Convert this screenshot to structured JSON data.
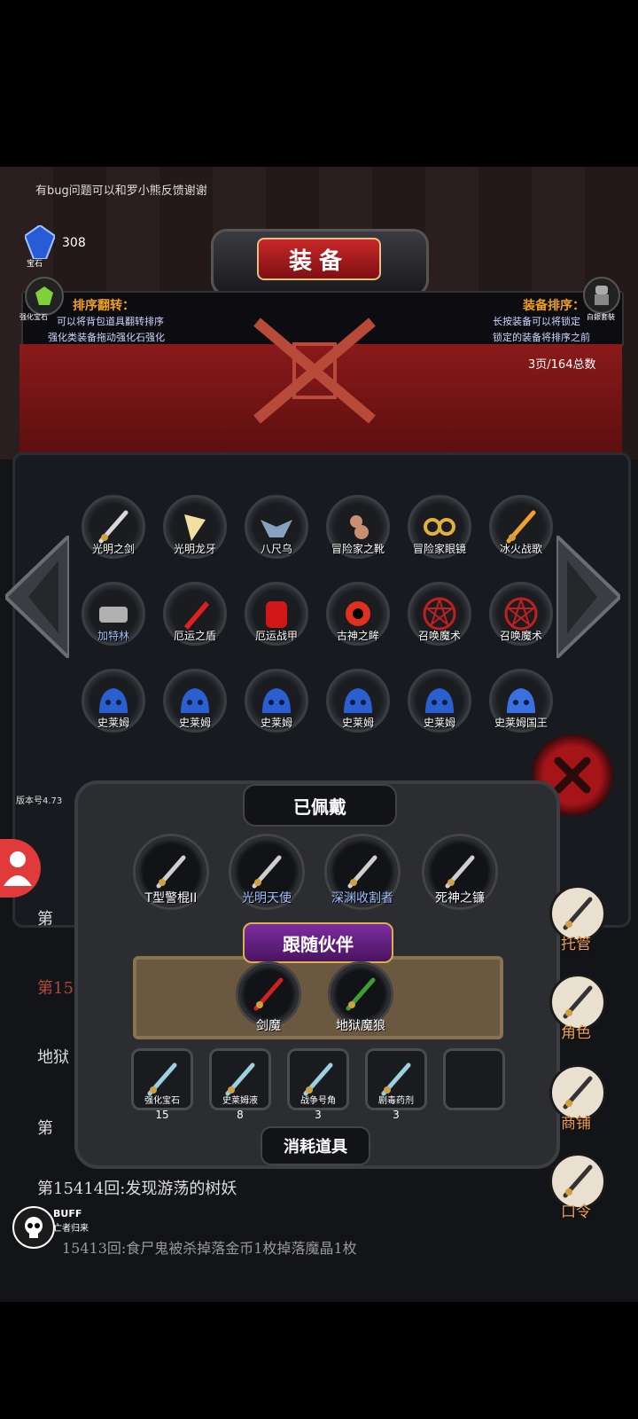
{
  "notice": "有bug问题可以和罗小熊反馈谢谢",
  "gem": {
    "count": "308",
    "label": "宝石"
  },
  "title": "装备",
  "left_badge": "强化宝石",
  "right_badge": "白銀套裝",
  "info": {
    "left_title": "排序翻转：",
    "left_lines": [
      "可以将背包道具翻转排序",
      "强化类装备拖动强化石强化"
    ],
    "right_title": "装备排序：",
    "right_lines": [
      "长按装备可以将锁定",
      "锁定的装备将排序之前"
    ]
  },
  "page_indicator": "3页/164总数",
  "inventory": [
    {
      "label": "光明之剑",
      "icon": "sword-icon",
      "color": "#d9d9d9"
    },
    {
      "label": "光明龙牙",
      "icon": "fang-icon",
      "color": "#f1e0a0"
    },
    {
      "label": "八尺乌",
      "icon": "crow-icon",
      "color": "#8aa0c0"
    },
    {
      "label": "冒险家之靴",
      "icon": "boots-icon",
      "color": "#c89070"
    },
    {
      "label": "冒险家眼镜",
      "icon": "goggles-icon",
      "color": "#e0b040"
    },
    {
      "label": "冰火战歌",
      "icon": "crossed-swords-icon",
      "color": "#f0a030"
    },
    {
      "label": "加特林",
      "icon": "gatling-icon",
      "color": "#b0b0b0"
    },
    {
      "label": "厄运之盾",
      "icon": "shield-icon",
      "color": "#e02020"
    },
    {
      "label": "厄运战甲",
      "icon": "armor-icon",
      "color": "#d01818"
    },
    {
      "label": "古神之眸",
      "icon": "eye-icon",
      "color": "#e03020"
    },
    {
      "label": "召唤魔术",
      "icon": "pentagram-icon",
      "color": "#c02020"
    },
    {
      "label": "召唤魔术",
      "icon": "pentagram-icon",
      "color": "#c02020"
    },
    {
      "label": "史莱姆",
      "icon": "slime-icon",
      "color": "#2b5fd0"
    },
    {
      "label": "史莱姆",
      "icon": "slime-icon",
      "color": "#2b5fd0"
    },
    {
      "label": "史莱姆",
      "icon": "slime-icon",
      "color": "#2b5fd0"
    },
    {
      "label": "史莱姆",
      "icon": "slime-icon",
      "color": "#2b5fd0"
    },
    {
      "label": "史莱姆",
      "icon": "slime-icon",
      "color": "#2b5fd0"
    },
    {
      "label": "史莱姆国王",
      "icon": "slime-king-icon",
      "color": "#3a70e0"
    }
  ],
  "version": "版本号4.73",
  "equipped_title": "已佩戴",
  "equipped": [
    {
      "label": "T型警棍II",
      "icon": "baton-icon",
      "color": "#fff"
    },
    {
      "label": "光明天使",
      "icon": "angel-icon",
      "color": "#9fc0ff"
    },
    {
      "label": "深渊收割者",
      "icon": "reaper-icon",
      "color": "#9fc0ff"
    },
    {
      "label": "死神之镰",
      "icon": "scythe-icon",
      "color": "#fff"
    }
  ],
  "companion_title": "跟随伙伴",
  "companions": [
    {
      "label": "剑魔",
      "icon": "sword-demon-icon"
    },
    {
      "label": "地狱魔狼",
      "icon": "hell-wolf-icon"
    }
  ],
  "consumables": [
    {
      "label": "强化宝石",
      "count": "15",
      "icon": "green-gem-icon"
    },
    {
      "label": "史莱姆液",
      "count": "8",
      "icon": "potion-icon"
    },
    {
      "label": "战争号角",
      "count": "3",
      "icon": "horn-icon"
    },
    {
      "label": "剧毒药剂",
      "count": "3",
      "icon": "poison-icon"
    },
    {
      "label": "",
      "count": "",
      "icon": "empty-slot"
    }
  ],
  "consumables_title": "消耗道具",
  "log": {
    "line1": "第15414回:发现游荡的树妖",
    "line2": "15413回:食尸鬼被杀掉落金币1枚掉落魔晶1枚",
    "partial_left": [
      "第",
      "第15",
      "地狱",
      "第"
    ]
  },
  "side_buttons": [
    {
      "label": "托管",
      "icon": "dice-icon"
    },
    {
      "label": "角色",
      "icon": "hooded-figure-icon"
    },
    {
      "label": "商铺",
      "icon": "shop-icon"
    },
    {
      "label": "口令",
      "icon": "scroll-icon"
    }
  ],
  "buff": {
    "title": "BUFF",
    "subtitle": "亡者归来"
  }
}
